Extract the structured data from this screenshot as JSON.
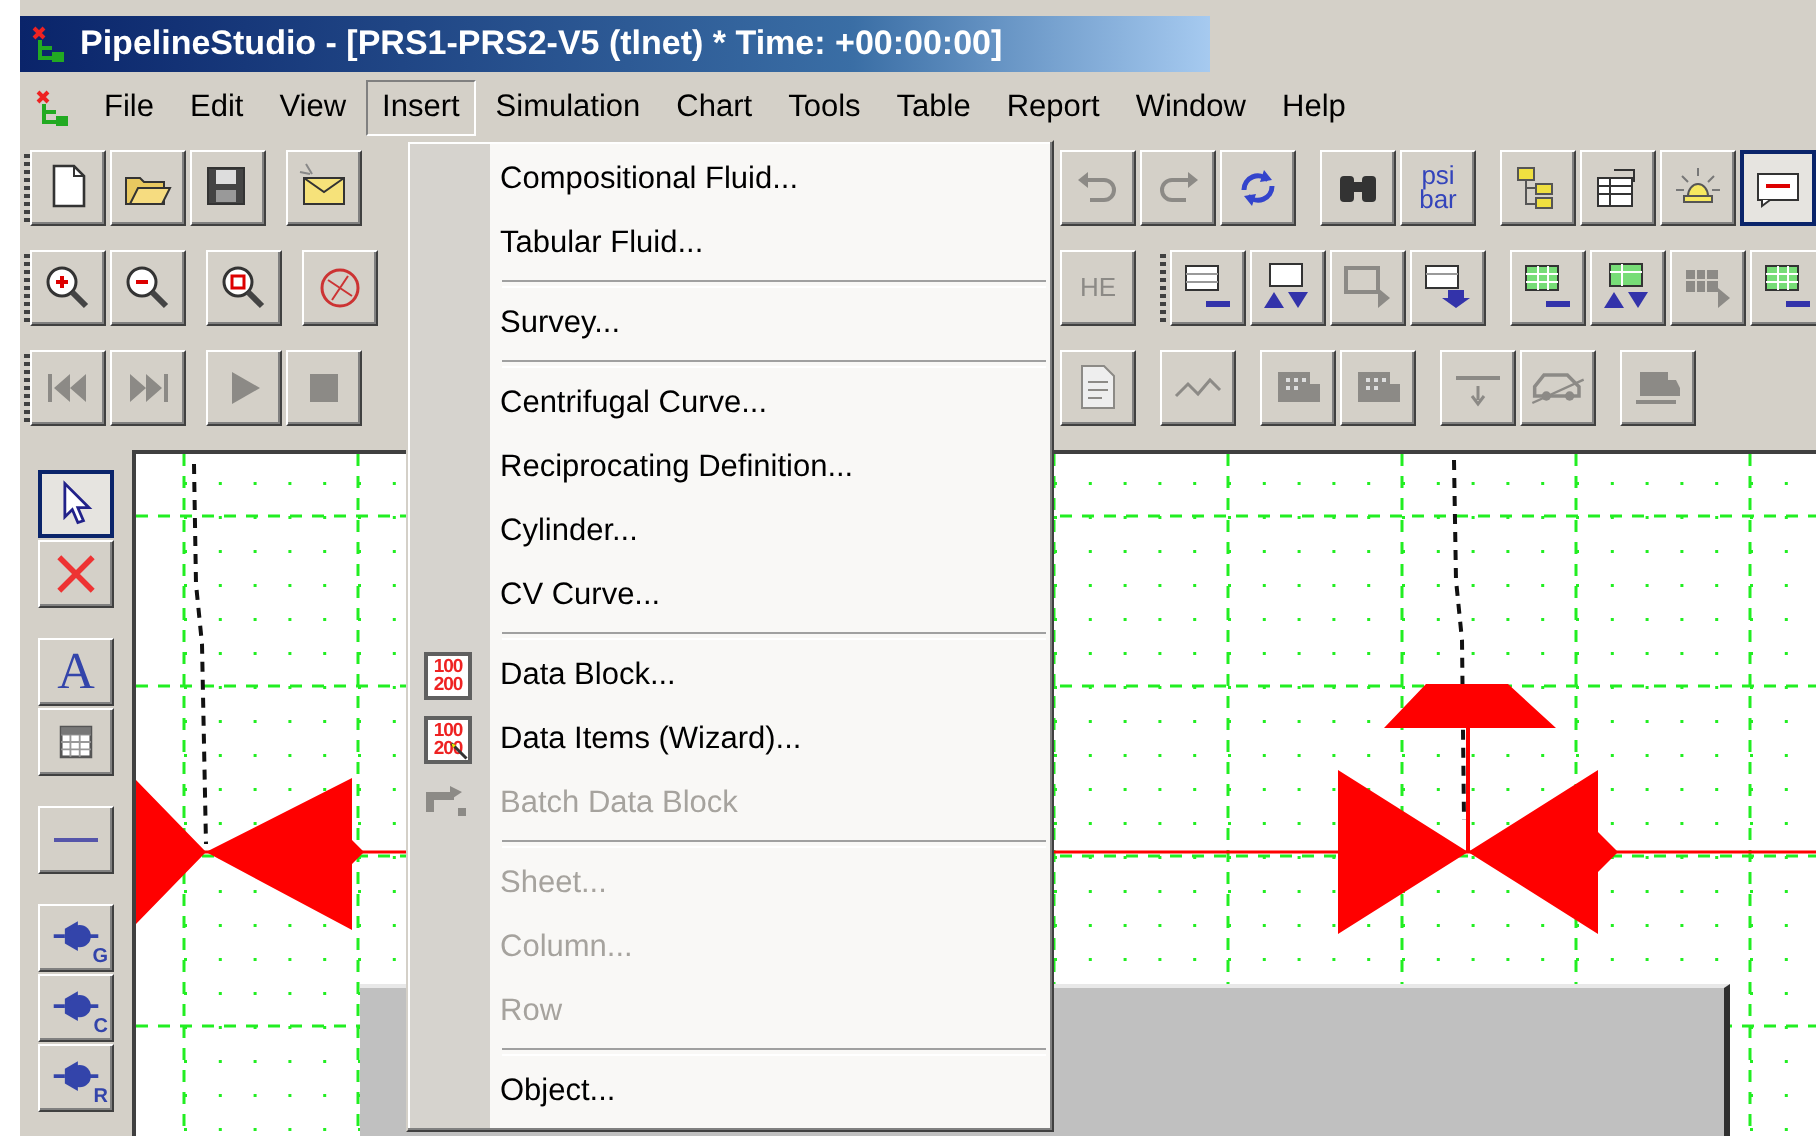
{
  "window": {
    "title": "PipelineStudio - [PRS1-PRS2-V5 (tlnet) * Time: +00:00:00]"
  },
  "menu_bar": [
    {
      "label": "File",
      "selected": false
    },
    {
      "label": "Edit",
      "selected": false
    },
    {
      "label": "View",
      "selected": false
    },
    {
      "label": "Insert",
      "selected": true
    },
    {
      "label": "Simulation",
      "selected": false
    },
    {
      "label": "Chart",
      "selected": false
    },
    {
      "label": "Tools",
      "selected": false
    },
    {
      "label": "Table",
      "selected": false
    },
    {
      "label": "Report",
      "selected": false
    },
    {
      "label": "Window",
      "selected": false
    },
    {
      "label": "Help",
      "selected": false
    }
  ],
  "toolbars": [
    {
      "left": [
        [
          {
            "kind": "new",
            "disabled": false
          },
          {
            "kind": "open",
            "disabled": false
          },
          {
            "kind": "save",
            "disabled": false
          }
        ],
        [
          {
            "kind": "mail",
            "disabled": false
          }
        ]
      ],
      "right": [
        [
          {
            "kind": "undo",
            "disabled": true
          },
          {
            "kind": "redo",
            "disabled": true
          },
          {
            "kind": "refresh",
            "disabled": false
          }
        ],
        [
          {
            "kind": "find",
            "disabled": false
          },
          {
            "kind": "units",
            "label": "psi bar",
            "disabled": false
          }
        ],
        [
          {
            "kind": "tree",
            "disabled": false
          },
          {
            "kind": "properties",
            "disabled": false
          },
          {
            "kind": "alarm",
            "disabled": false
          },
          {
            "kind": "note",
            "disabled": false,
            "selected": true
          }
        ]
      ]
    },
    {
      "left": [
        [
          {
            "kind": "zoom-in",
            "disabled": false
          },
          {
            "kind": "zoom-out",
            "disabled": false
          }
        ],
        [
          {
            "kind": "zoom-box",
            "disabled": false
          }
        ],
        [
          {
            "kind": "circle",
            "disabled": false
          }
        ]
      ],
      "right": [
        [
          {
            "kind": "he",
            "label": "HE",
            "disabled": true
          }
        ],
        [
          {
            "kind": "table-minus",
            "disabled": false
          },
          {
            "kind": "table-arrows",
            "disabled": false
          },
          {
            "kind": "table-right",
            "disabled": true
          },
          {
            "kind": "table-down",
            "disabled": false
          }
        ],
        [
          {
            "kind": "green-minus",
            "disabled": false
          },
          {
            "kind": "green-arrows",
            "disabled": false
          },
          {
            "kind": "green-right",
            "disabled": true
          },
          {
            "kind": "green-minus",
            "disabled": false
          }
        ]
      ]
    },
    {
      "left": [
        [
          {
            "kind": "first",
            "disabled": true
          },
          {
            "kind": "last",
            "disabled": true
          }
        ],
        [
          {
            "kind": "play",
            "disabled": true
          },
          {
            "kind": "stop",
            "disabled": true
          }
        ]
      ],
      "right": [
        [
          {
            "kind": "doc",
            "disabled": true
          }
        ],
        [
          {
            "kind": "wave",
            "disabled": true
          }
        ],
        [
          {
            "kind": "machine",
            "disabled": true
          },
          {
            "kind": "machine",
            "disabled": true
          }
        ],
        [
          {
            "kind": "flow-down",
            "disabled": true
          },
          {
            "kind": "car",
            "disabled": true
          }
        ],
        [
          {
            "kind": "truck",
            "disabled": true
          }
        ]
      ]
    }
  ],
  "side_toolbar": [
    [
      {
        "kind": "pointer",
        "selected": true
      },
      {
        "kind": "delete",
        "selected": false
      }
    ],
    [
      {
        "kind": "text",
        "label": "A",
        "selected": false
      },
      {
        "kind": "table",
        "selected": false
      }
    ],
    [
      {
        "kind": "line",
        "selected": false
      }
    ],
    [
      {
        "kind": "compressor",
        "label": "G",
        "selected": false
      },
      {
        "kind": "compressor",
        "label": "C",
        "selected": false
      },
      {
        "kind": "compressor",
        "label": "R",
        "selected": false
      }
    ]
  ],
  "insert_menu": [
    {
      "kind": "item",
      "label": "Compositional Fluid...",
      "disabled": false
    },
    {
      "kind": "item",
      "label": "Tabular Fluid...",
      "disabled": false
    },
    {
      "kind": "separator"
    },
    {
      "kind": "item",
      "label": "Survey...",
      "disabled": false
    },
    {
      "kind": "separator"
    },
    {
      "kind": "item",
      "label": "Centrifugal Curve...",
      "disabled": false
    },
    {
      "kind": "item",
      "label": "Reciprocating Definition...",
      "disabled": false
    },
    {
      "kind": "item",
      "label": "Cylinder...",
      "disabled": false
    },
    {
      "kind": "item",
      "label": "CV Curve...",
      "disabled": false
    },
    {
      "kind": "separator"
    },
    {
      "kind": "data-item",
      "label": "Data Block...",
      "disabled": false,
      "icon_text": [
        "100",
        "200"
      ]
    },
    {
      "kind": "wizard-item",
      "label": "Data Items (Wizard)...",
      "disabled": false,
      "icon_text": [
        "100",
        "200"
      ]
    },
    {
      "kind": "batch-item",
      "label": "Batch Data Block",
      "disabled": true
    },
    {
      "kind": "separator"
    },
    {
      "kind": "item",
      "label": "Sheet...",
      "disabled": true
    },
    {
      "kind": "item",
      "label": "Column...",
      "disabled": true
    },
    {
      "kind": "item",
      "label": "Row",
      "disabled": true
    },
    {
      "kind": "separator"
    },
    {
      "kind": "item",
      "label": "Object...",
      "disabled": false
    }
  ]
}
